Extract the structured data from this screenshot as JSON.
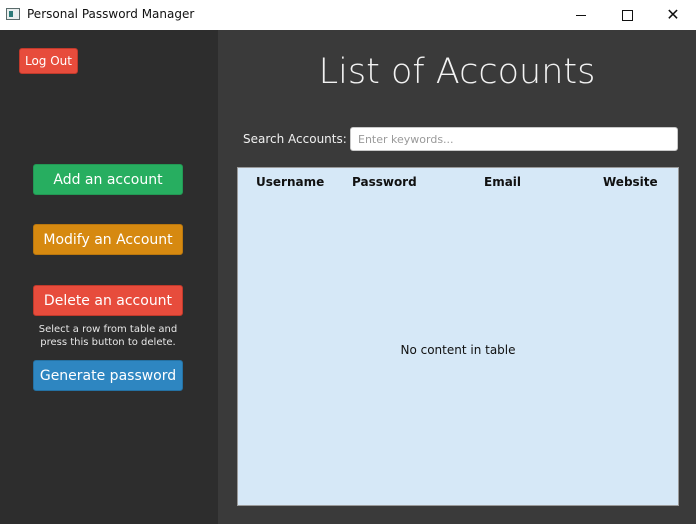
{
  "window": {
    "title": "Personal Password Manager",
    "close_glyph": "✕"
  },
  "sidebar": {
    "logout_label": "Log Out",
    "add_label": "Add an account",
    "modify_label": "Modify an Account",
    "delete_label": "Delete an account",
    "delete_hint": "Select a row from table and press this button to delete.",
    "generate_label": "Generate password"
  },
  "main": {
    "title": "List of Accounts",
    "search": {
      "label": "Search Accounts:",
      "placeholder": "Enter keywords...",
      "value": ""
    },
    "table": {
      "columns": [
        "Username",
        "Password",
        "Email",
        "Website"
      ],
      "rows": [],
      "empty_message": "No content in table"
    }
  },
  "colors": {
    "sidebar_bg": "#2d2d2d",
    "main_bg": "#3a3a3a",
    "table_bg": "#d6e8f7",
    "logout": "#e74c3c",
    "add": "#27ae60",
    "modify": "#d68910",
    "delete": "#e74c3c",
    "generate": "#2e86c1"
  }
}
